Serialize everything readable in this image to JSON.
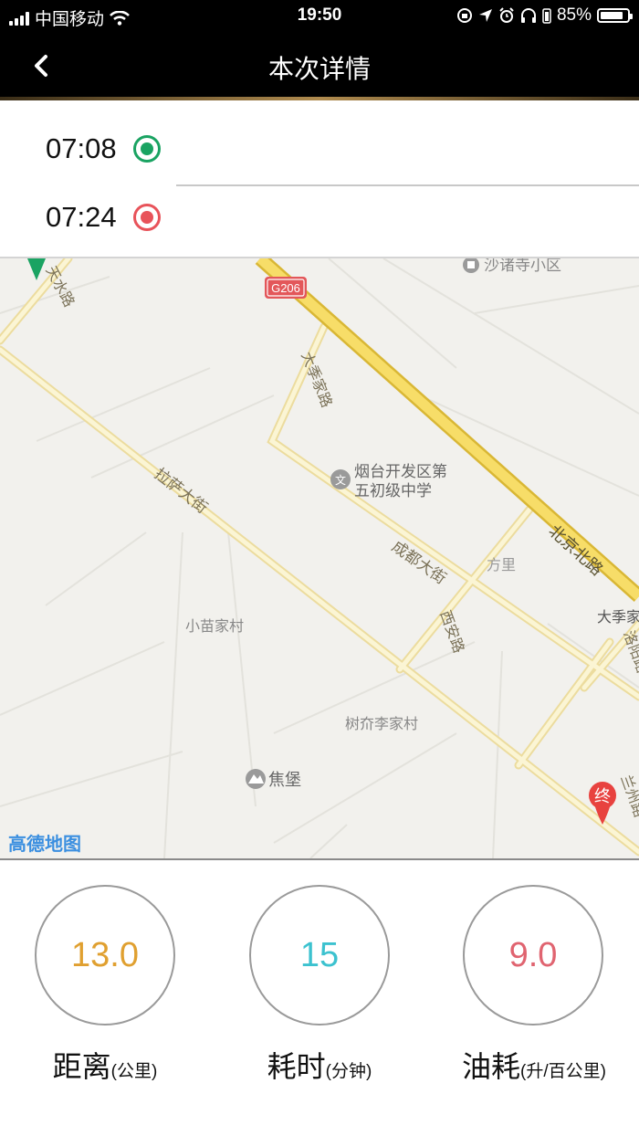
{
  "status_bar": {
    "carrier": "中国移动",
    "time": "19:50",
    "battery": "85%",
    "battery_level": 0.85
  },
  "nav": {
    "title": "本次详情"
  },
  "trip": {
    "start_time": "07:08",
    "end_time": "07:24"
  },
  "map": {
    "labels": {
      "shuzhu": "沙诸寺小区",
      "g206": "G206",
      "daji": "大季家路",
      "school1": "烟台开发区第",
      "school2": "五初级中学",
      "beijing": "北京北路",
      "lhasa": "拉萨大街",
      "chengdu": "成都大街",
      "fangli": "方里",
      "xian": "西安路",
      "dajijia": "大季家",
      "luoyang": "洛阳路",
      "xiaomiao": "小苗家村",
      "shujie": "树夼李家村",
      "jiaobao": "焦堡",
      "tianshui": "天水路",
      "wen": "文",
      "end_marker": "终",
      "other_road": "兰州路",
      "amap": "高德地图"
    }
  },
  "stats": {
    "distance": {
      "value": "13.0",
      "label": "距离",
      "unit": "(公里)",
      "color": "#e0a030"
    },
    "duration": {
      "value": "15",
      "label": "耗时",
      "unit": "(分钟)",
      "color": "#3cc2cf"
    },
    "fuel": {
      "value": "9.0",
      "label": "油耗",
      "unit": "(升/百公里)",
      "color": "#e06470"
    }
  }
}
